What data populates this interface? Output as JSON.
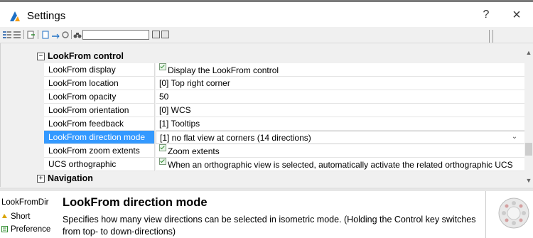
{
  "window": {
    "title": "Settings",
    "help": "?",
    "close": "×"
  },
  "toolbar": {
    "search_placeholder": ""
  },
  "grid": {
    "category_main": "LookFrom control",
    "rows": [
      {
        "name": "LookFrom display",
        "value": "Display the LookFrom control",
        "checkbox": true
      },
      {
        "name": "LookFrom location",
        "value": "[0] Top right corner",
        "checkbox": false
      },
      {
        "name": "LookFrom opacity",
        "value": "50",
        "checkbox": false
      },
      {
        "name": "LookFrom orientation",
        "value": "[0] WCS",
        "checkbox": false
      },
      {
        "name": "LookFrom feedback",
        "value": "[1] Tooltips",
        "checkbox": false
      },
      {
        "name": "LookFrom direction mode",
        "value": "[1] no flat view at corners (14 directions)",
        "checkbox": false
      },
      {
        "name": "LookFrom zoom extents",
        "value": "Zoom extents",
        "checkbox": true
      },
      {
        "name": "UCS orthographic",
        "value": "When an orthographic view is selected, automatically activate the related orthographic UCS",
        "checkbox": true
      }
    ],
    "category_next": "Navigation",
    "selected_index": 5,
    "dropdown_glyph": "⌄"
  },
  "description": {
    "short_name": "LookFromDir",
    "tab_short": "Short",
    "tab_preference": "Preference",
    "title": "LookFrom direction mode",
    "text": "Specifies how many view directions can be selected in isometric mode. (Holding the Control key switches from top- to down-directions)"
  },
  "colors": {
    "selection": "#3399ff",
    "accent_icon": "#1e6fc4"
  }
}
